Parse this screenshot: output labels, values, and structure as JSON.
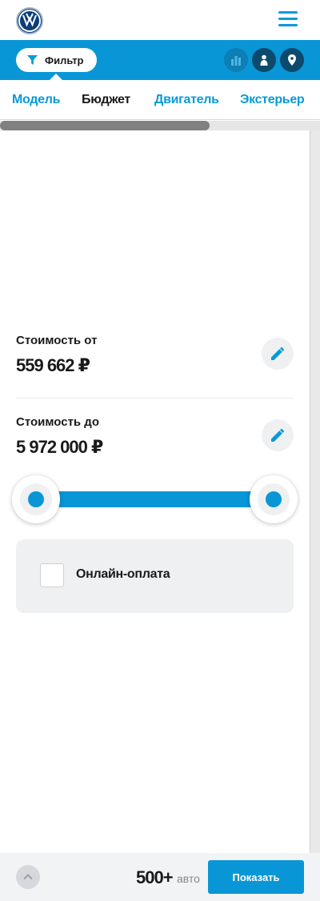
{
  "header": {
    "logo_icon": "vw-logo-icon",
    "menu_icon": "hamburger-menu-icon"
  },
  "filter_bar": {
    "filter_label": "Фильтр",
    "filter_icon": "funnel-icon",
    "actions": [
      {
        "icon": "bar-chart-icon",
        "state": "disabled"
      },
      {
        "icon": "person-icon",
        "state": "enabled"
      },
      {
        "icon": "map-pin-icon",
        "state": "enabled"
      }
    ],
    "colors": {
      "bar": "#0996d6",
      "dark_button": "#0b4a6c"
    }
  },
  "tabs": [
    {
      "label": "Модель",
      "active": false
    },
    {
      "label": "Бюджет",
      "active": true
    },
    {
      "label": "Двигатель",
      "active": false
    },
    {
      "label": "Экстерьер",
      "active": false
    }
  ],
  "budget": {
    "from_label": "Стоимость от",
    "from_value": "559 662 ₽",
    "to_label": "Стоимость до",
    "to_value": "5 972 000 ₽",
    "edit_icon": "pencil-icon",
    "range_slider": {
      "min_position": 0,
      "max_position": 1
    }
  },
  "online_payment": {
    "label": "Онлайн-оплата",
    "checked": false
  },
  "footer": {
    "scroll_up_icon": "chevron-up-icon",
    "count": "500+",
    "count_unit": "авто",
    "show_label": "Показать"
  },
  "colors": {
    "accent": "#0996d6",
    "text": "#1a1a1a",
    "muted": "#8a8a8a"
  }
}
